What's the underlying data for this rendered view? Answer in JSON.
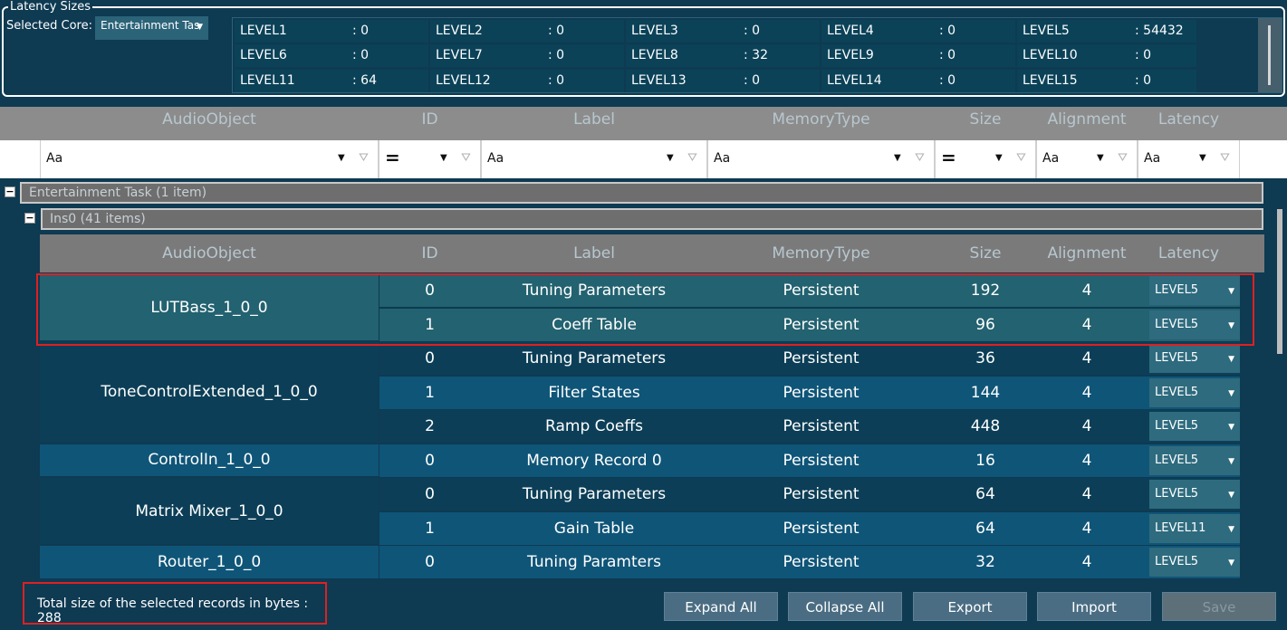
{
  "latency": {
    "title": "Latency Sizes",
    "core_label": "Selected Core:",
    "core_value": "Entertainment Tas",
    "levels": [
      {
        "name": "LEVEL1",
        "value": ": 0"
      },
      {
        "name": "LEVEL2",
        "value": ": 0"
      },
      {
        "name": "LEVEL3",
        "value": ": 0"
      },
      {
        "name": "LEVEL4",
        "value": ": 0"
      },
      {
        "name": "LEVEL5",
        "value": ": 54432"
      },
      {
        "name": "LEVEL6",
        "value": ": 0"
      },
      {
        "name": "LEVEL7",
        "value": ": 0"
      },
      {
        "name": "LEVEL8",
        "value": ": 32"
      },
      {
        "name": "LEVEL9",
        "value": ": 0"
      },
      {
        "name": "LEVEL10",
        "value": ": 0"
      },
      {
        "name": "LEVEL11",
        "value": ": 64"
      },
      {
        "name": "LEVEL12",
        "value": ": 0"
      },
      {
        "name": "LEVEL13",
        "value": ": 0"
      },
      {
        "name": "LEVEL14",
        "value": ": 0"
      },
      {
        "name": "LEVEL15",
        "value": ": 0"
      }
    ]
  },
  "columns": [
    "AudioObject",
    "ID",
    "Label",
    "MemoryType",
    "Size",
    "Alignment",
    "Latency"
  ],
  "filters": {
    "text_op": "Aa",
    "eq_op": "=",
    "dropdown_glyph": "▼",
    "filter_glyph": "⛛"
  },
  "groups": {
    "core": "Entertainment Task (1 item)",
    "instance": "Ins0 (41 items)",
    "toggle": "−"
  },
  "objects": [
    {
      "name": "LUTBass_1_0_0",
      "records": [
        {
          "id": "0",
          "label": "Tuning Parameters",
          "memtype": "Persistent",
          "size": "192",
          "align": "4",
          "latency": "LEVEL5"
        },
        {
          "id": "1",
          "label": "Coeff Table",
          "memtype": "Persistent",
          "size": "96",
          "align": "4",
          "latency": "LEVEL5"
        }
      ]
    },
    {
      "name": "ToneControlExtended_1_0_0",
      "records": [
        {
          "id": "0",
          "label": "Tuning Parameters",
          "memtype": "Persistent",
          "size": "36",
          "align": "4",
          "latency": "LEVEL5"
        },
        {
          "id": "1",
          "label": "Filter States",
          "memtype": "Persistent",
          "size": "144",
          "align": "4",
          "latency": "LEVEL5"
        },
        {
          "id": "2",
          "label": "Ramp Coeffs",
          "memtype": "Persistent",
          "size": "448",
          "align": "4",
          "latency": "LEVEL5"
        }
      ]
    },
    {
      "name": "ControlIn_1_0_0",
      "records": [
        {
          "id": "0",
          "label": "Memory Record 0",
          "memtype": "Persistent",
          "size": "16",
          "align": "4",
          "latency": "LEVEL5"
        }
      ]
    },
    {
      "name": "Matrix Mixer_1_0_0",
      "records": [
        {
          "id": "0",
          "label": "Tuning Parameters",
          "memtype": "Persistent",
          "size": "64",
          "align": "4",
          "latency": "LEVEL5"
        },
        {
          "id": "1",
          "label": "Gain Table",
          "memtype": "Persistent",
          "size": "64",
          "align": "4",
          "latency": "LEVEL11"
        }
      ]
    },
    {
      "name": "Router_1_0_0",
      "records": [
        {
          "id": "0",
          "label": "Tuning Paramters",
          "memtype": "Persistent",
          "size": "32",
          "align": "4",
          "latency": "LEVEL5"
        }
      ]
    }
  ],
  "total_text": "Total size of the selected records in bytes : 288",
  "buttons": {
    "expand": "Expand All",
    "collapse": "Collapse All",
    "export": "Export",
    "import": "Import",
    "save": "Save"
  },
  "colors": {
    "background": "#0e3a52",
    "row_selected": "#236270",
    "row_dark": "#0c3f57",
    "row_light": "#0f5578",
    "highlight_border": "#e02020"
  }
}
